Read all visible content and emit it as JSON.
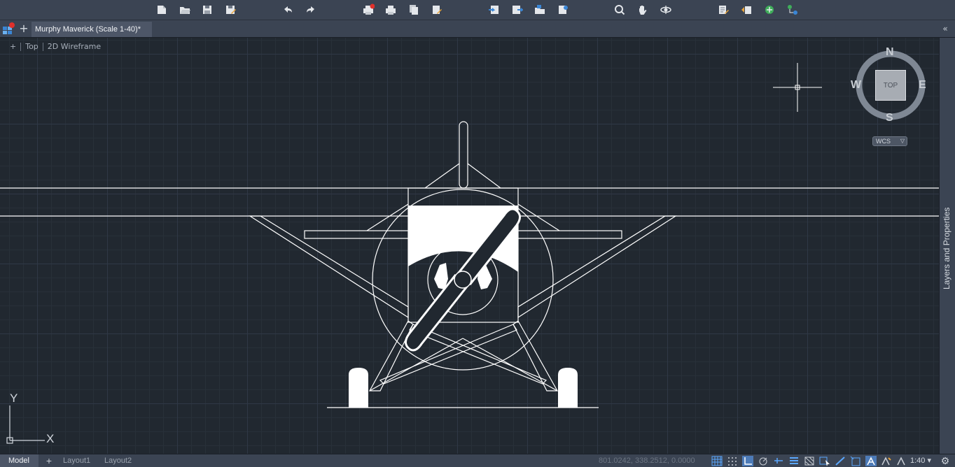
{
  "toolbar": {
    "icons": [
      "new-drawing-icon",
      "open-icon",
      "save-icon",
      "save-as-icon",
      "undo-icon",
      "redo-icon",
      "plot-icon",
      "print-preview-icon",
      "publish-icon",
      "batch-plot-icon",
      "import-icon",
      "export-icon",
      "attach-icon",
      "etransmit-icon",
      "zoom-icon",
      "pan-icon",
      "orbit-icon",
      "properties-icon",
      "match-properties-icon",
      "layer-icon",
      "layer-states-icon"
    ]
  },
  "tabs": {
    "plus": "+",
    "document_tab": "Murphy Maverick (Scale 1-40)*",
    "collapse": "«"
  },
  "viewport": {
    "control": "+",
    "view": "Top",
    "visual_style": "2D Wireframe"
  },
  "viewcube": {
    "north": "N",
    "south": "S",
    "east": "E",
    "west": "W",
    "face": "TOP",
    "coordinate_system": "WCS"
  },
  "ucs": {
    "x_label": "X",
    "y_label": "Y"
  },
  "palette": {
    "label": "Layers and Properties"
  },
  "status": {
    "model_tab": "Model",
    "plus": "+",
    "layout_tabs": [
      "Layout1",
      "Layout2"
    ],
    "coordinates": "801.0242, 338.2512, 0.0000",
    "annotation_scale": "1:40",
    "icons": [
      "grid-icon",
      "snap-icon",
      "ortho-icon",
      "polar-icon",
      "isodraft-icon",
      "lineweight-icon",
      "transparency-icon",
      "selection-cycling-icon",
      "osnap-icon",
      "dynamic-ucs-icon",
      "annotation-monitor-icon",
      "annotation-visibility-icon",
      "auto-scale-icon",
      "annotation-scale-icon",
      "customize-icon"
    ]
  },
  "colors": {
    "background": "#212830",
    "chrome": "#3b4453",
    "linework": "#ffffff"
  }
}
